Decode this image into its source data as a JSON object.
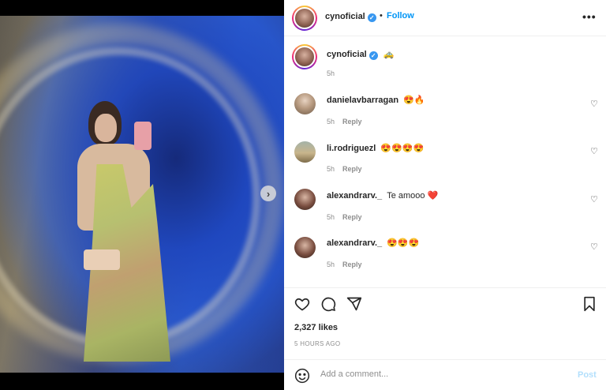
{
  "post": {
    "username": "cynoficial",
    "verified_icon": "verified-badge-icon",
    "follow_label": "Follow",
    "dot": "•",
    "more_label": "•••",
    "caption_emoji": "🚕",
    "caption_time": "5h",
    "likes": "2,327 likes",
    "posted_ago": "5 HOURS AGO"
  },
  "comments": [
    {
      "user": "danielavbarragan",
      "text": "😍🔥",
      "time": "5h",
      "reply": "Reply"
    },
    {
      "user": "li.rodriguezl",
      "text": "😍😍😍😍",
      "time": "5h",
      "reply": "Reply"
    },
    {
      "user": "alexandrarv._",
      "text": "Te amooo ❤️",
      "time": "5h",
      "reply": "Reply"
    },
    {
      "user": "alexandrarv._",
      "text": "😍😍😍",
      "time": "5h",
      "reply": "Reply"
    }
  ],
  "composer": {
    "placeholder": "Add a comment...",
    "post_label": "Post",
    "emoji_icon": "smiley-icon"
  },
  "media": {
    "next_arrow": "›",
    "close_label": "✕"
  },
  "colors": {
    "accent": "#0095f6",
    "post_disabled": "#b2dffc",
    "verified": "#3897f0",
    "text": "#262626",
    "muted": "#8e8e8e"
  }
}
